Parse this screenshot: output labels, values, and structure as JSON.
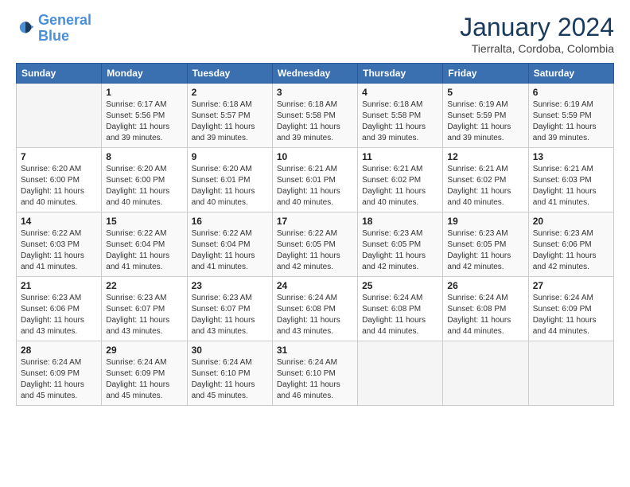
{
  "header": {
    "logo_line1": "General",
    "logo_line2": "Blue",
    "month_title": "January 2024",
    "location": "Tierralta, Cordoba, Colombia"
  },
  "weekdays": [
    "Sunday",
    "Monday",
    "Tuesday",
    "Wednesday",
    "Thursday",
    "Friday",
    "Saturday"
  ],
  "weeks": [
    [
      {
        "day": "",
        "info": ""
      },
      {
        "day": "1",
        "info": "Sunrise: 6:17 AM\nSunset: 5:56 PM\nDaylight: 11 hours\nand 39 minutes."
      },
      {
        "day": "2",
        "info": "Sunrise: 6:18 AM\nSunset: 5:57 PM\nDaylight: 11 hours\nand 39 minutes."
      },
      {
        "day": "3",
        "info": "Sunrise: 6:18 AM\nSunset: 5:58 PM\nDaylight: 11 hours\nand 39 minutes."
      },
      {
        "day": "4",
        "info": "Sunrise: 6:18 AM\nSunset: 5:58 PM\nDaylight: 11 hours\nand 39 minutes."
      },
      {
        "day": "5",
        "info": "Sunrise: 6:19 AM\nSunset: 5:59 PM\nDaylight: 11 hours\nand 39 minutes."
      },
      {
        "day": "6",
        "info": "Sunrise: 6:19 AM\nSunset: 5:59 PM\nDaylight: 11 hours\nand 39 minutes."
      }
    ],
    [
      {
        "day": "7",
        "info": "Sunrise: 6:20 AM\nSunset: 6:00 PM\nDaylight: 11 hours\nand 40 minutes."
      },
      {
        "day": "8",
        "info": "Sunrise: 6:20 AM\nSunset: 6:00 PM\nDaylight: 11 hours\nand 40 minutes."
      },
      {
        "day": "9",
        "info": "Sunrise: 6:20 AM\nSunset: 6:01 PM\nDaylight: 11 hours\nand 40 minutes."
      },
      {
        "day": "10",
        "info": "Sunrise: 6:21 AM\nSunset: 6:01 PM\nDaylight: 11 hours\nand 40 minutes."
      },
      {
        "day": "11",
        "info": "Sunrise: 6:21 AM\nSunset: 6:02 PM\nDaylight: 11 hours\nand 40 minutes."
      },
      {
        "day": "12",
        "info": "Sunrise: 6:21 AM\nSunset: 6:02 PM\nDaylight: 11 hours\nand 40 minutes."
      },
      {
        "day": "13",
        "info": "Sunrise: 6:21 AM\nSunset: 6:03 PM\nDaylight: 11 hours\nand 41 minutes."
      }
    ],
    [
      {
        "day": "14",
        "info": "Sunrise: 6:22 AM\nSunset: 6:03 PM\nDaylight: 11 hours\nand 41 minutes."
      },
      {
        "day": "15",
        "info": "Sunrise: 6:22 AM\nSunset: 6:04 PM\nDaylight: 11 hours\nand 41 minutes."
      },
      {
        "day": "16",
        "info": "Sunrise: 6:22 AM\nSunset: 6:04 PM\nDaylight: 11 hours\nand 41 minutes."
      },
      {
        "day": "17",
        "info": "Sunrise: 6:22 AM\nSunset: 6:05 PM\nDaylight: 11 hours\nand 42 minutes."
      },
      {
        "day": "18",
        "info": "Sunrise: 6:23 AM\nSunset: 6:05 PM\nDaylight: 11 hours\nand 42 minutes."
      },
      {
        "day": "19",
        "info": "Sunrise: 6:23 AM\nSunset: 6:05 PM\nDaylight: 11 hours\nand 42 minutes."
      },
      {
        "day": "20",
        "info": "Sunrise: 6:23 AM\nSunset: 6:06 PM\nDaylight: 11 hours\nand 42 minutes."
      }
    ],
    [
      {
        "day": "21",
        "info": "Sunrise: 6:23 AM\nSunset: 6:06 PM\nDaylight: 11 hours\nand 43 minutes."
      },
      {
        "day": "22",
        "info": "Sunrise: 6:23 AM\nSunset: 6:07 PM\nDaylight: 11 hours\nand 43 minutes."
      },
      {
        "day": "23",
        "info": "Sunrise: 6:23 AM\nSunset: 6:07 PM\nDaylight: 11 hours\nand 43 minutes."
      },
      {
        "day": "24",
        "info": "Sunrise: 6:24 AM\nSunset: 6:08 PM\nDaylight: 11 hours\nand 43 minutes."
      },
      {
        "day": "25",
        "info": "Sunrise: 6:24 AM\nSunset: 6:08 PM\nDaylight: 11 hours\nand 44 minutes."
      },
      {
        "day": "26",
        "info": "Sunrise: 6:24 AM\nSunset: 6:08 PM\nDaylight: 11 hours\nand 44 minutes."
      },
      {
        "day": "27",
        "info": "Sunrise: 6:24 AM\nSunset: 6:09 PM\nDaylight: 11 hours\nand 44 minutes."
      }
    ],
    [
      {
        "day": "28",
        "info": "Sunrise: 6:24 AM\nSunset: 6:09 PM\nDaylight: 11 hours\nand 45 minutes."
      },
      {
        "day": "29",
        "info": "Sunrise: 6:24 AM\nSunset: 6:09 PM\nDaylight: 11 hours\nand 45 minutes."
      },
      {
        "day": "30",
        "info": "Sunrise: 6:24 AM\nSunset: 6:10 PM\nDaylight: 11 hours\nand 45 minutes."
      },
      {
        "day": "31",
        "info": "Sunrise: 6:24 AM\nSunset: 6:10 PM\nDaylight: 11 hours\nand 46 minutes."
      },
      {
        "day": "",
        "info": ""
      },
      {
        "day": "",
        "info": ""
      },
      {
        "day": "",
        "info": ""
      }
    ]
  ]
}
